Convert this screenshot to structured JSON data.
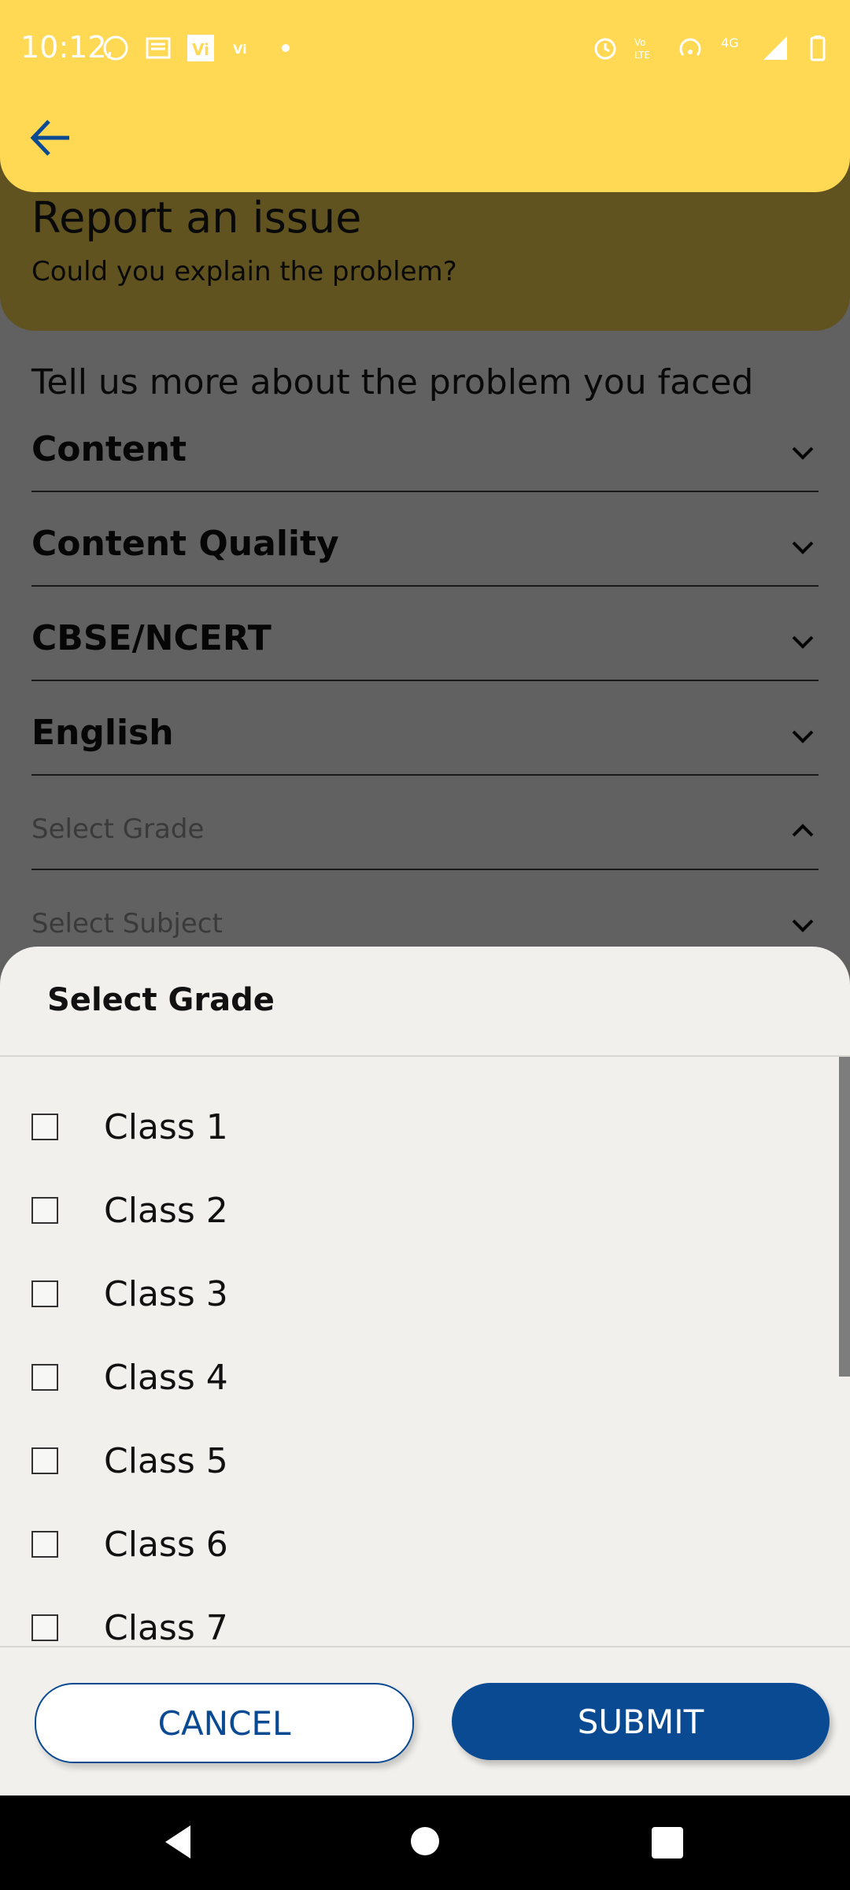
{
  "status_bar": {
    "time": "10:12",
    "left_icons": [
      "whatsapp-icon",
      "news-icon",
      "vi-icon",
      "vi-small-icon",
      "dot-icon"
    ],
    "right_icons": [
      "alarm-icon",
      "volte-icon",
      "hotspot-icon",
      "4g-icon",
      "signal-icon",
      "battery-icon"
    ],
    "network": "4G"
  },
  "header": {
    "back_icon": "arrow-left-icon",
    "title": "Report an issue",
    "subtitle": "Could you explain the problem?"
  },
  "form": {
    "question": "Tell us more about the problem you faced",
    "dropdowns": [
      {
        "label": "Content",
        "placeholder": false,
        "state": "collapsed"
      },
      {
        "label": "Content Quality",
        "placeholder": false,
        "state": "collapsed"
      },
      {
        "label": "CBSE/NCERT",
        "placeholder": false,
        "state": "collapsed"
      },
      {
        "label": "English",
        "placeholder": false,
        "state": "collapsed"
      },
      {
        "label": "Select Grade",
        "placeholder": true,
        "state": "expanded"
      },
      {
        "label": "Select Subject",
        "placeholder": true,
        "state": "collapsed"
      }
    ]
  },
  "sheet": {
    "title": "Select Grade",
    "options": [
      {
        "label": "Class 1",
        "checked": false
      },
      {
        "label": "Class 2",
        "checked": false
      },
      {
        "label": "Class 3",
        "checked": false
      },
      {
        "label": "Class 4",
        "checked": false
      },
      {
        "label": "Class 5",
        "checked": false
      },
      {
        "label": "Class 6",
        "checked": false
      },
      {
        "label": "Class 7",
        "checked": false
      }
    ],
    "cancel_label": "CANCEL",
    "submit_label": "SUBMIT"
  },
  "colors": {
    "header_yellow": "#ffd954",
    "primary_blue": "#0a4a93",
    "sheet_bg": "#f1f0ec"
  },
  "nav_bar": {
    "icons": [
      "back-triangle-icon",
      "home-circle-icon",
      "recents-square-icon"
    ]
  }
}
